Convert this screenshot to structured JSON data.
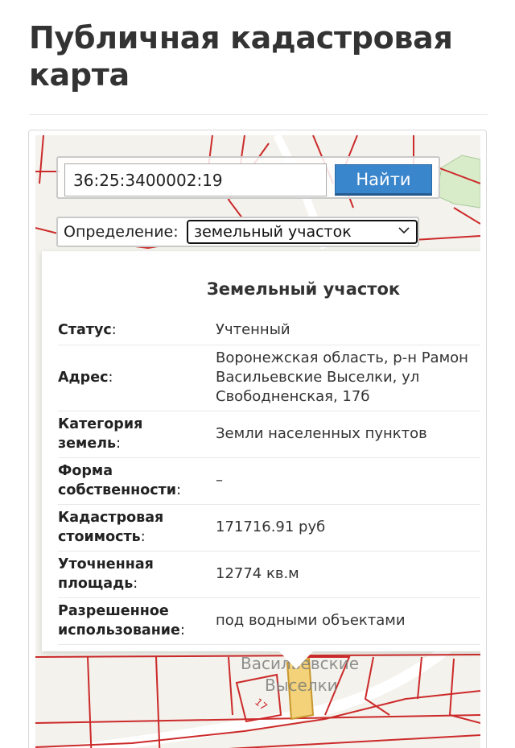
{
  "page": {
    "title": "Публичная кадастровая карта"
  },
  "search": {
    "value": "36:25:3400002:19",
    "button_label": "Найти"
  },
  "definition": {
    "label": "Определение:",
    "selected": "земельный участок"
  },
  "card": {
    "title": "Земельный участок",
    "rows": [
      {
        "label": "Статус",
        "value": "Учтенный"
      },
      {
        "label": "Адрес",
        "value_lines": [
          "Воронежская область, р-н Рамон",
          "Васильевские Выселки, ул",
          "Свободненская, 17б"
        ]
      },
      {
        "label_lines": [
          "Категория",
          "земель"
        ],
        "value": "Земли населенных пунктов"
      },
      {
        "label_lines": [
          "Форма",
          "собственности"
        ],
        "value": "–"
      },
      {
        "label_lines": [
          "Кадастровая",
          "стоимость"
        ],
        "value": "171716.91 руб"
      },
      {
        "label_lines": [
          "Уточненная",
          "площадь"
        ],
        "value": "12774 кв.м"
      },
      {
        "label_lines": [
          "Разрешенное",
          "использование"
        ],
        "value": "под водными объектами"
      }
    ],
    "colon": ":"
  },
  "map": {
    "place_label_line1": "Васильевские",
    "place_label_line2": "Выселки",
    "parcel_number": "17",
    "colors": {
      "boundary": "#cc2a2a",
      "background": "#f3f2ec",
      "green": "#d9ecc9",
      "selected_parcel": "#f3d27a"
    }
  }
}
